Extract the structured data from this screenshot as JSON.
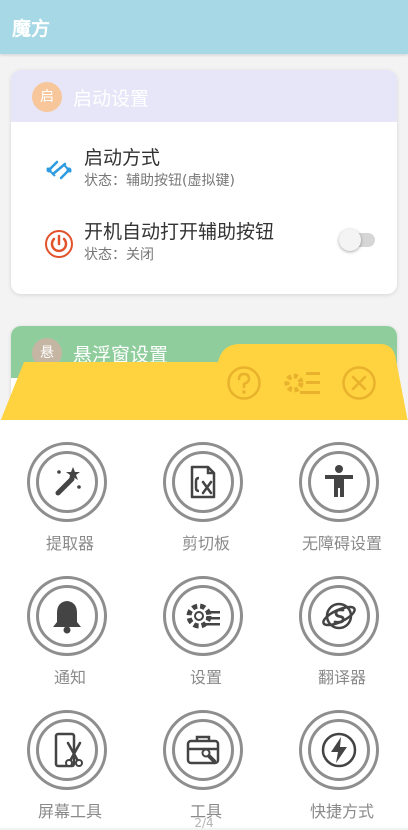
{
  "app": {
    "title": "魔方"
  },
  "startup_card": {
    "badge": "启",
    "title": "启动设置",
    "rows": [
      {
        "title": "启动方式",
        "subtitle": "状态：辅助按钮(虚拟键)"
      },
      {
        "title": "开机自动打开辅助按钮",
        "subtitle": "状态：关闭",
        "toggle_on": false
      }
    ]
  },
  "float_card": {
    "badge": "悬",
    "title": "悬浮窗设置"
  },
  "panel": {
    "items": [
      {
        "label": "提取器",
        "icon": "magic-wand-icon"
      },
      {
        "label": "剪切板",
        "icon": "clipboard-icon"
      },
      {
        "label": "无障碍设置",
        "icon": "accessibility-icon"
      },
      {
        "label": "通知",
        "icon": "bell-icon"
      },
      {
        "label": "设置",
        "icon": "gear-icon"
      },
      {
        "label": "翻译器",
        "icon": "translate-icon"
      },
      {
        "label": "屏幕工具",
        "icon": "screen-tool-icon"
      },
      {
        "label": "工具",
        "icon": "toolbox-icon"
      },
      {
        "label": "快捷方式",
        "icon": "lightning-icon"
      }
    ],
    "page_indicator": "2/4"
  },
  "colors": {
    "appbar": "#a6d8e6",
    "startup_header": "#e6e6f8",
    "float_header": "#8fcd9c",
    "panel_yellow": "#ffd23f",
    "icon_gray": "#8e8e8e"
  }
}
